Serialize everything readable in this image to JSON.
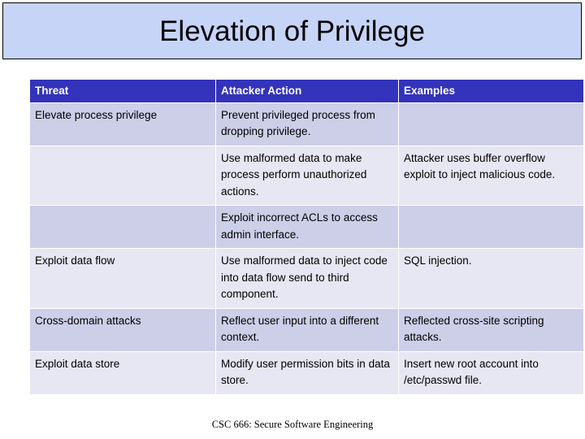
{
  "slide": {
    "title": "Elevation of Privilege",
    "footer": "CSC 666: Secure Software Engineering"
  },
  "colors": {
    "title_banner_bg": "#c6d4f8",
    "title_banner_border": "#000000",
    "header_bg": "#3333bb",
    "header_text": "#ffffff",
    "row_shade_dark": "#cdcee8",
    "row_shade_light": "#e7e6f3",
    "body_text": "#000000",
    "page_bg": "#ffffff"
  },
  "table": {
    "headers": [
      "Threat",
      "Attacker Action",
      "Examples"
    ],
    "rows": [
      {
        "shade": "dark",
        "threat": "Elevate process privilege",
        "action": "Prevent privileged process from dropping privilege.",
        "examples": ""
      },
      {
        "shade": "light",
        "threat": "",
        "action": "Use malformed data to make process perform unauthorized actions.",
        "examples": "Attacker uses buffer overflow exploit to inject malicious code."
      },
      {
        "shade": "dark",
        "threat": "",
        "action": "Exploit incorrect ACLs to access admin interface.",
        "examples": ""
      },
      {
        "shade": "light",
        "threat": "Exploit data flow",
        "action": "Use malformed data to inject code into data flow send to third component.",
        "examples": "SQL injection."
      },
      {
        "shade": "dark",
        "threat": "Cross-domain attacks",
        "action": "Reflect user input into a different context.",
        "examples": "Reflected cross-site scripting attacks."
      },
      {
        "shade": "light",
        "threat": "Exploit data store",
        "action": "Modify user permission bits in data store.",
        "examples": "Insert new root account into /etc/passwd file."
      }
    ]
  }
}
